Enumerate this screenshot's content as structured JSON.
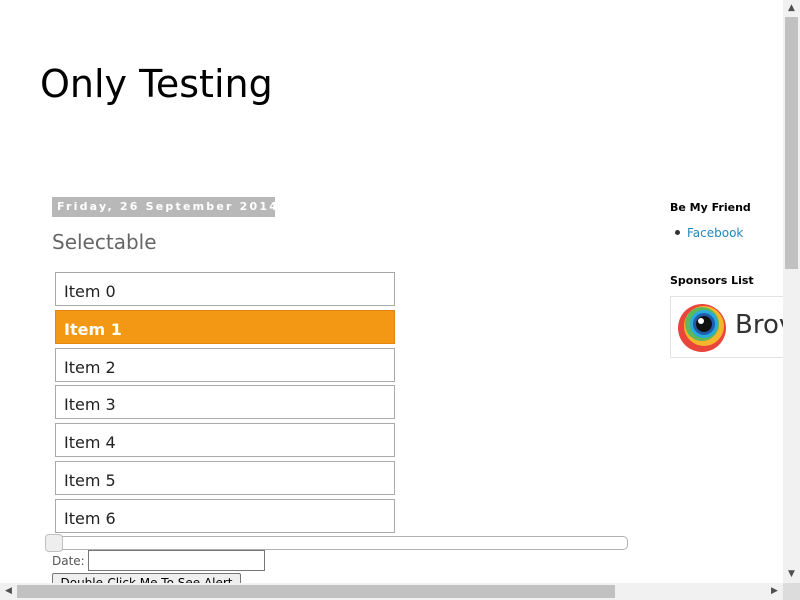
{
  "site": {
    "title": "Only Testing"
  },
  "post": {
    "date_header": "Friday, 26 September 2014",
    "title": "Selectable",
    "selectable_items": [
      {
        "label": "Item 0",
        "selected": false
      },
      {
        "label": "Item 1",
        "selected": true
      },
      {
        "label": "Item 2",
        "selected": false
      },
      {
        "label": "Item 3",
        "selected": false
      },
      {
        "label": "Item 4",
        "selected": false
      },
      {
        "label": "Item 5",
        "selected": false
      },
      {
        "label": "Item 6",
        "selected": false
      }
    ],
    "slider_value": 0,
    "date_label": "Date:",
    "date_value": "",
    "double_click_button": "Double-Click Me To See Alert"
  },
  "sidebar": {
    "be_my_friend_heading": "Be My Friend",
    "friend_links": [
      "Facebook"
    ],
    "sponsors_heading": "Sponsors List",
    "sponsor_text": "Brov"
  },
  "colors": {
    "selected_item": "#f39814",
    "date_header_bg": "#b8b8b8",
    "link": "#2288bb"
  },
  "icons": {
    "scroll_up": "▲",
    "scroll_down": "▼",
    "scroll_left": "◀",
    "scroll_right": "▶"
  }
}
